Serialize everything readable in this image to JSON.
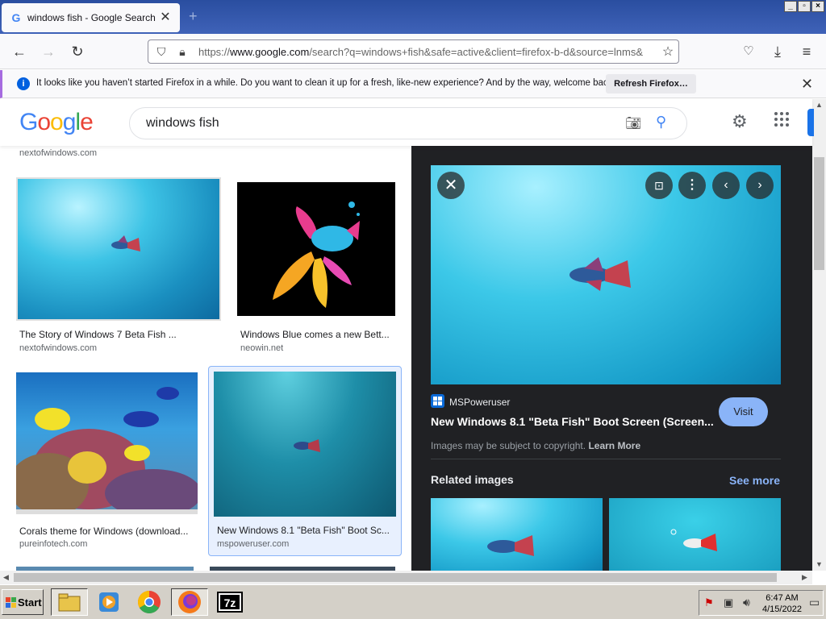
{
  "browser": {
    "tab_title": "windows fish - Google Search",
    "tab_favicon": "G",
    "url_host": "www.google.com",
    "url_prefix": "https://",
    "url_rest": "/search?q=windows+fish&safe=active&client=firefox-b-d&source=lnms&",
    "window_controls": [
      "_",
      "▫",
      "×"
    ]
  },
  "notification": {
    "text": "It looks like you haven’t started Firefox in a while. Do you want to clean it up for a fresh, like-new experience? And by the way, welcome back!",
    "button": "Refresh Firefox…"
  },
  "google": {
    "logo": [
      "G",
      "o",
      "o",
      "g",
      "l",
      "e"
    ],
    "query": "windows fish"
  },
  "results": {
    "top_source": "nextofwindows.com",
    "cards": [
      {
        "title": "The Story of Windows 7 Beta Fish ...",
        "source": "nextofwindows.com"
      },
      {
        "title": "Windows Blue comes a new Bett...",
        "source": "neowin.net"
      },
      {
        "title": "Corals theme for Windows (download...",
        "source": "pureinfotech.com"
      },
      {
        "title": "New Windows 8.1 \"Beta Fish\" Boot Sc...",
        "source": "mspoweruser.com"
      }
    ]
  },
  "detail": {
    "source_name": "MSPoweruser",
    "title": "New Windows 8.1 \"Beta Fish\" Boot Screen (Screen...",
    "visit": "Visit",
    "copyright": "Images may be subject to copyright.",
    "learn_more": "Learn More",
    "related": "Related images",
    "see_more": "See more"
  },
  "taskbar": {
    "start": "Start",
    "time": "6:47 AM",
    "date": "4/15/2022",
    "apps": [
      "file-explorer",
      "media-player",
      "chrome",
      "firefox",
      "7zip"
    ]
  },
  "colors": {
    "accent": "#1a73e8",
    "detail_bg": "#202124",
    "link": "#8ab4f8"
  }
}
